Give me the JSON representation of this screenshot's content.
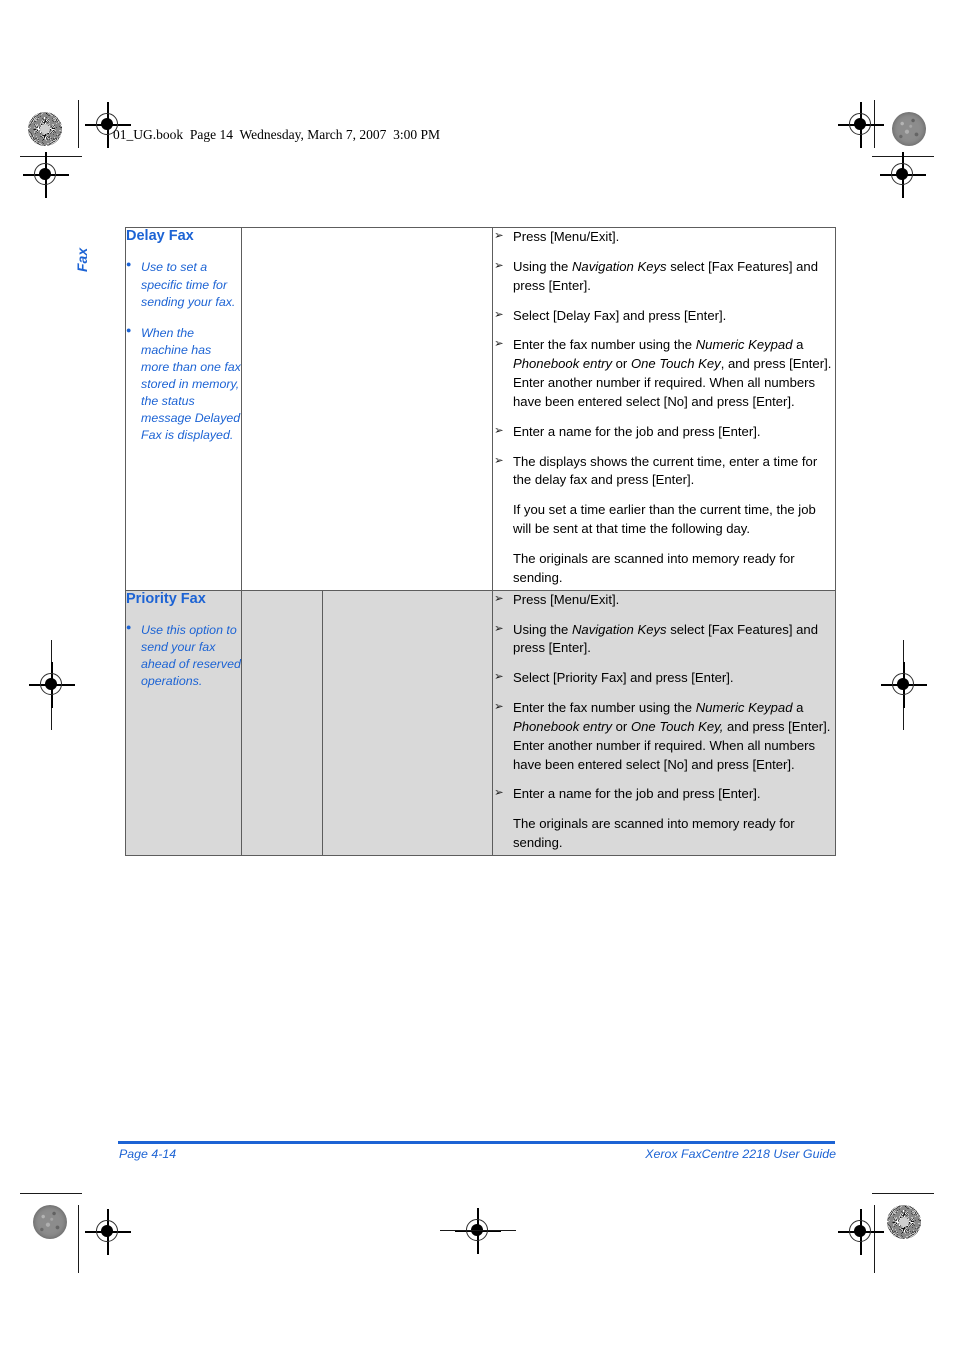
{
  "page": {
    "file_header": "01_UG.book  Page 14  Wednesday, March 7, 2007  3:00 PM",
    "side_tab": "Fax",
    "accent_color": "#1c63d4",
    "shade_color": "#d9d9d9"
  },
  "footer": {
    "page_number": "Page 4-14",
    "guide_title": "Xerox FaxCentre 2218 User Guide"
  },
  "table": {
    "rows": [
      {
        "title": "Delay Fax",
        "shaded": false,
        "notes": [
          "Use to set a specific time for sending your fax.",
          "When the machine has more than one fax stored in memory, the status message Delayed Fax is displayed."
        ],
        "steps": [
          {
            "bulleted": true,
            "parts": [
              {
                "text": "Press [Menu/Exit].",
                "italic": false
              }
            ]
          },
          {
            "bulleted": true,
            "parts": [
              {
                "text": "Using the ",
                "italic": false
              },
              {
                "text": "Navigation Keys",
                "italic": true
              },
              {
                "text": " select [Fax Features] and press [Enter].",
                "italic": false
              }
            ]
          },
          {
            "bulleted": true,
            "parts": [
              {
                "text": "Select [Delay Fax] and press [Enter].",
                "italic": false
              }
            ]
          },
          {
            "bulleted": true,
            "parts": [
              {
                "text": "Enter the fax number using the ",
                "italic": false
              },
              {
                "text": "Numeric Keypad",
                "italic": true
              },
              {
                "text": " a ",
                "italic": false
              },
              {
                "text": "Phonebook entry",
                "italic": true
              },
              {
                "text": " or ",
                "italic": false
              },
              {
                "text": "One Touch Key",
                "italic": true
              },
              {
                "text": ", and press [Enter]. Enter another number if required. When all numbers have been entered select [No] and press [Enter].",
                "italic": false
              }
            ]
          },
          {
            "bulleted": true,
            "parts": [
              {
                "text": "Enter a name for the job and press [Enter].",
                "italic": false
              }
            ]
          },
          {
            "bulleted": true,
            "parts": [
              {
                "text": "The displays shows the current time, enter a time for the delay fax and press [Enter].",
                "italic": false
              }
            ]
          },
          {
            "bulleted": false,
            "parts": [
              {
                "text": "If you set a time earlier than the current time, the job will be sent at that time the following day.",
                "italic": false
              }
            ]
          },
          {
            "bulleted": false,
            "parts": [
              {
                "text": "The originals are scanned into memory ready for sending.",
                "italic": false
              }
            ]
          }
        ]
      },
      {
        "title": "Priority Fax",
        "shaded": true,
        "notes": [
          "Use this option to send your fax ahead of reserved operations."
        ],
        "steps": [
          {
            "bulleted": true,
            "parts": [
              {
                "text": "Press [Menu/Exit].",
                "italic": false
              }
            ]
          },
          {
            "bulleted": true,
            "parts": [
              {
                "text": "Using the ",
                "italic": false
              },
              {
                "text": "Navigation Keys",
                "italic": true
              },
              {
                "text": " select [Fax Features] and press [Enter].",
                "italic": false
              }
            ]
          },
          {
            "bulleted": true,
            "parts": [
              {
                "text": "Select [Priority Fax] and press [Enter].",
                "italic": false
              }
            ]
          },
          {
            "bulleted": true,
            "parts": [
              {
                "text": "Enter the fax number using the ",
                "italic": false
              },
              {
                "text": "Numeric Keypad",
                "italic": true
              },
              {
                "text": " a ",
                "italic": false
              },
              {
                "text": "Phonebook entry",
                "italic": true
              },
              {
                "text": " or ",
                "italic": false
              },
              {
                "text": "One Touch Key,",
                "italic": true
              },
              {
                "text": " and press [Enter]. Enter another number if required. When all numbers have been entered select [No] and press [Enter].",
                "italic": false
              }
            ]
          },
          {
            "bulleted": true,
            "parts": [
              {
                "text": "Enter a name for the job and press [Enter].",
                "italic": false
              }
            ]
          },
          {
            "bulleted": false,
            "parts": [
              {
                "text": "The originals are scanned into memory ready for sending.",
                "italic": false
              }
            ]
          }
        ]
      }
    ]
  }
}
